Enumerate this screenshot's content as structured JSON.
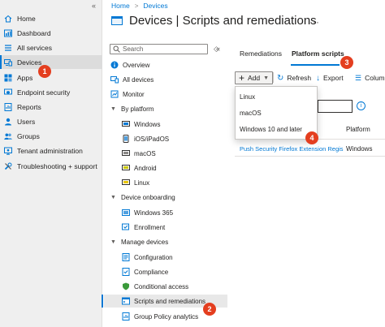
{
  "breadcrumb": {
    "home": "Home",
    "current": "Devices"
  },
  "page": {
    "title": "Devices | Scripts and remediations"
  },
  "left_nav": {
    "items": [
      {
        "label": "Home",
        "icon": "home-icon"
      },
      {
        "label": "Dashboard",
        "icon": "dashboard-icon"
      },
      {
        "label": "All services",
        "icon": "all-services-icon"
      },
      {
        "label": "Devices",
        "icon": "devices-icon",
        "active": true
      },
      {
        "label": "Apps",
        "icon": "apps-icon"
      },
      {
        "label": "Endpoint security",
        "icon": "endpoint-security-icon"
      },
      {
        "label": "Reports",
        "icon": "reports-icon"
      },
      {
        "label": "Users",
        "icon": "users-icon"
      },
      {
        "label": "Groups",
        "icon": "groups-icon"
      },
      {
        "label": "Tenant administration",
        "icon": "tenant-admin-icon"
      },
      {
        "label": "Troubleshooting + support",
        "icon": "troubleshooting-icon"
      }
    ]
  },
  "blade": {
    "search_placeholder": "Search",
    "items": [
      {
        "label": "Overview"
      },
      {
        "label": "All devices"
      },
      {
        "label": "Monitor"
      },
      {
        "label": "By platform"
      },
      {
        "label": "Windows"
      },
      {
        "label": "iOS/iPadOS"
      },
      {
        "label": "macOS"
      },
      {
        "label": "Android"
      },
      {
        "label": "Linux"
      },
      {
        "label": "Device onboarding"
      },
      {
        "label": "Windows 365"
      },
      {
        "label": "Enrollment"
      },
      {
        "label": "Manage devices"
      },
      {
        "label": "Configuration"
      },
      {
        "label": "Compliance"
      },
      {
        "label": "Conditional access"
      },
      {
        "label": "Scripts and remediations",
        "active": true
      },
      {
        "label": "Group Policy analytics"
      }
    ]
  },
  "tabs": [
    {
      "label": "Remediations"
    },
    {
      "label": "Platform scripts",
      "selected": true
    }
  ],
  "toolbar": {
    "add": "Add",
    "refresh": "Refresh",
    "export": "Export",
    "columns": "Colum"
  },
  "add_menu": {
    "items": [
      "Linux",
      "macOS",
      "Windows 10 and later"
    ]
  },
  "table": {
    "platform_header": "Platform",
    "rows": [
      {
        "name": "Push Security Firefox Extension Regis",
        "platform": "Windows"
      }
    ]
  },
  "callouts": [
    "1",
    "2",
    "3",
    "4"
  ],
  "colors": {
    "accent": "#0078d4",
    "callout": "#e43e1f",
    "nav_bg": "#efefef"
  }
}
